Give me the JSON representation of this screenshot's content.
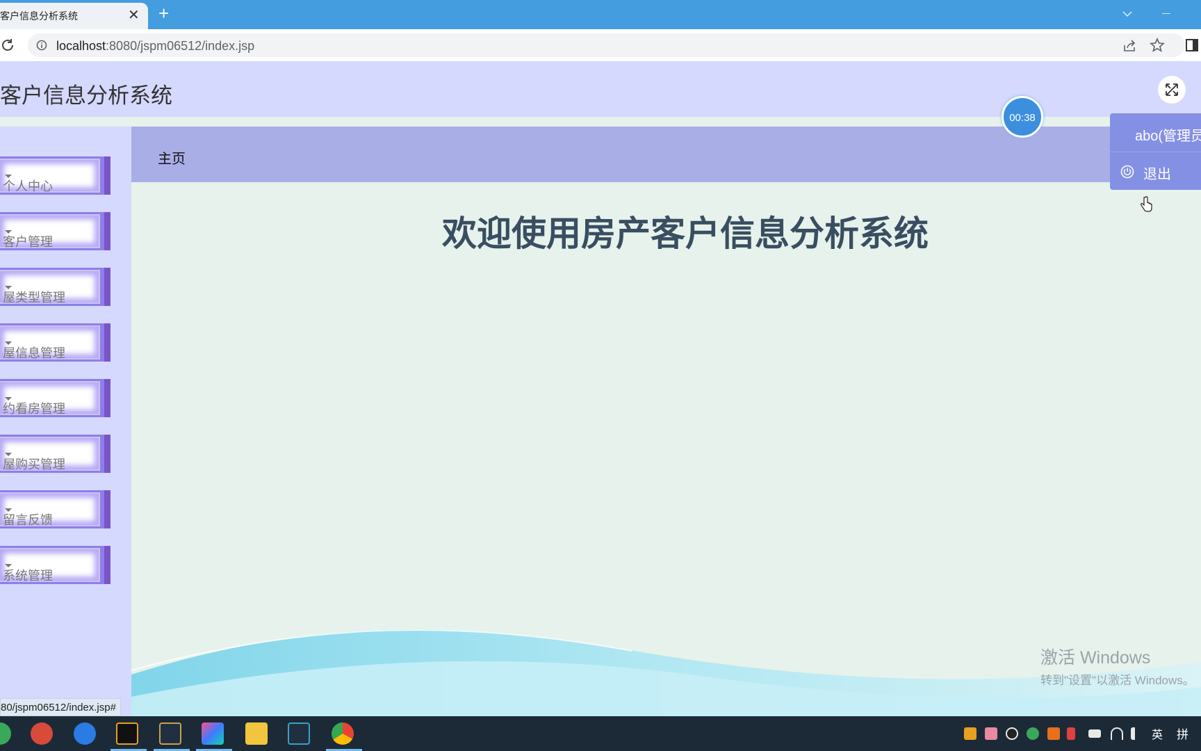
{
  "browser": {
    "tab_title": "客户信息分析系统",
    "url_host": "localhost",
    "url_path": ":8080/jspm06512/index.jsp",
    "status_url": "80/jspm06512/index.jsp#"
  },
  "header": {
    "title": "客户信息分析系统"
  },
  "sidebar": {
    "items": [
      {
        "label": "个人中心"
      },
      {
        "label": "客户管理"
      },
      {
        "label": "屋类型管理"
      },
      {
        "label": "屋信息管理"
      },
      {
        "label": "约看房管理"
      },
      {
        "label": "屋购买管理"
      },
      {
        "label": "留言反馈"
      },
      {
        "label": "系统管理"
      }
    ]
  },
  "breadcrumb": {
    "home": "主页"
  },
  "main": {
    "welcome": "欢迎使用房产客户信息分析系统"
  },
  "timer": {
    "text": "00:38"
  },
  "user_menu": {
    "name": "abo(管理员",
    "logout": "退出"
  },
  "watermark": {
    "line1": "激活 Windows",
    "line2": "转到\"设置\"以激活 Windows。"
  },
  "taskbar": {
    "lang": "英",
    "ime": "拼"
  },
  "colors": {
    "tabstrip": "#439ddf",
    "header_bg": "#d5d9fd",
    "breadcrumb_bg": "#aaaee7",
    "menu_accent": "#7b55c8",
    "welcome_text": "#3a4e62",
    "user_menu_bg": "#8490e3"
  }
}
